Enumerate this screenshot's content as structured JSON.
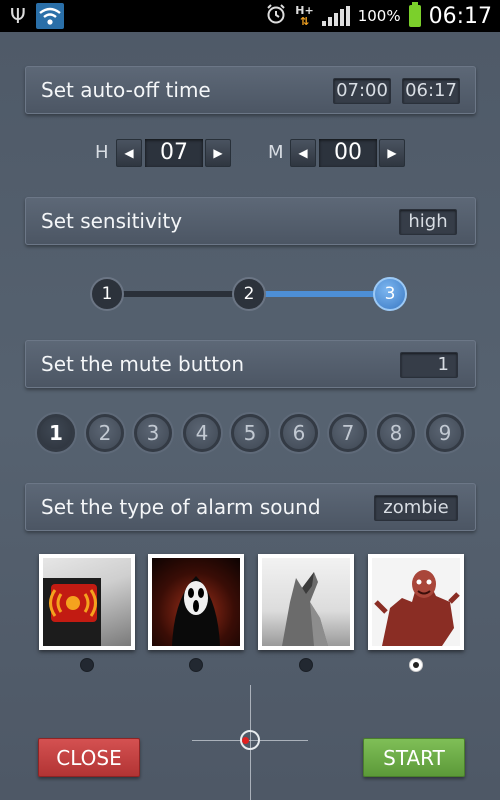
{
  "status_bar": {
    "battery_percent": "100%",
    "network": "H+",
    "time": "06:17",
    "icons": [
      "usb-icon",
      "wifi-icon",
      "alarm-clock-icon",
      "network-hplus-icon",
      "signal-icon",
      "battery-charging-icon"
    ]
  },
  "auto_off": {
    "title": "Set auto-off time",
    "set_time": "07:00",
    "current_time": "06:17"
  },
  "time_spinners": {
    "hour_label": "H",
    "hour_value": "07",
    "minute_label": "M",
    "minute_value": "00",
    "decrement_symbol": "◀",
    "increment_symbol": "▶"
  },
  "sensitivity": {
    "title": "Set sensitivity",
    "value": "high",
    "levels": [
      "1",
      "2",
      "3"
    ],
    "selected_level": 3
  },
  "mute_button": {
    "title": "Set the mute button",
    "value": "1",
    "options": [
      "1",
      "2",
      "3",
      "4",
      "5",
      "6",
      "7",
      "8",
      "9"
    ],
    "selected": 1
  },
  "alarm_sound": {
    "title": "Set the type of alarm sound",
    "value": "zombie",
    "options": [
      {
        "name": "siren",
        "selected": false
      },
      {
        "name": "scream",
        "selected": false
      },
      {
        "name": "wolf",
        "selected": false
      },
      {
        "name": "zombie",
        "selected": true
      }
    ]
  },
  "buttons": {
    "close": "CLOSE",
    "start": "START"
  },
  "colors": {
    "accent_blue": "#4d8fd6",
    "close_red": "#c43f3f",
    "start_green": "#6cab48"
  }
}
